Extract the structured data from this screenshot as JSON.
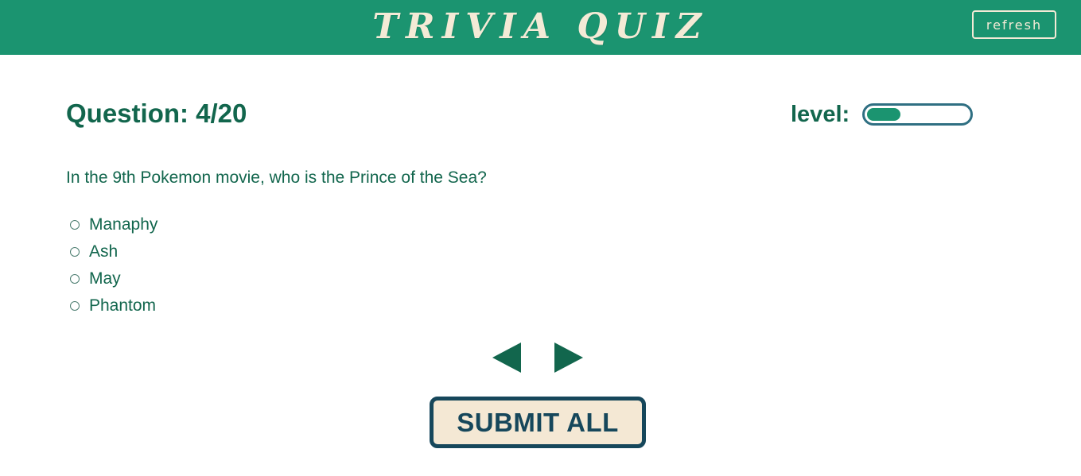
{
  "header": {
    "title": "TRIVIA QUIZ",
    "refresh_label": "refresh"
  },
  "quiz": {
    "question_counter": "Question: 4/20",
    "level_label": "level:",
    "level_fraction": 0.33,
    "question_text": "In the 9th Pokemon movie, who is the Prince of the Sea?",
    "answers": [
      {
        "label": "Manaphy"
      },
      {
        "label": "Ash"
      },
      {
        "label": "May"
      },
      {
        "label": "Phantom"
      }
    ],
    "prev_icon": "triangle-left-icon",
    "next_icon": "triangle-right-icon",
    "submit_label": "SUBMIT ALL"
  },
  "colors": {
    "header_bg": "#1b9470",
    "title_text": "#f4ead6",
    "primary_text": "#12664d",
    "submit_border": "#16475b",
    "submit_bg": "#f4e8d4",
    "level_border": "#2f6f82",
    "level_fill": "#1b9470"
  }
}
